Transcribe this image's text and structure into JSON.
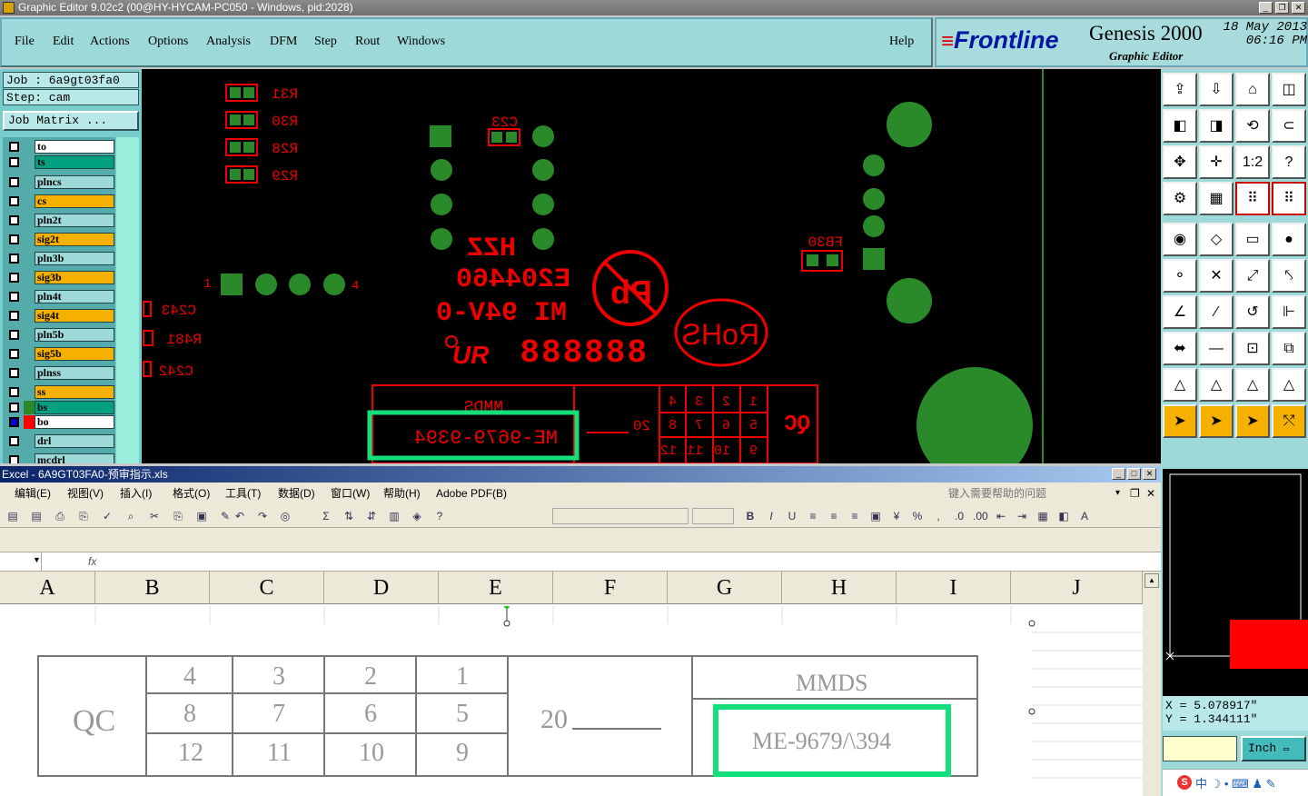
{
  "window": {
    "title": "Graphic Editor 9.02c2 (00@HY-HYCAM-PC050 - Windows, pid:2028)"
  },
  "menu": {
    "items": [
      "File",
      "Edit",
      "Actions",
      "Options",
      "Analysis",
      "DFM",
      "Step",
      "Rout",
      "Windows"
    ],
    "help": "Help"
  },
  "brand": {
    "logo": "Frontline",
    "product": "Genesis 2000",
    "subtitle": "Graphic Editor",
    "date": "18 May 2013",
    "time": "06:16 PM"
  },
  "job": {
    "job_line": "Job : 6a9gt03fa0",
    "step_line": "Step: cam",
    "matrix_button": "Job Matrix ..."
  },
  "layers": [
    {
      "name": "to",
      "bg": "#ffffff",
      "swatch": ""
    },
    {
      "name": "ts",
      "bg": "#00a080",
      "swatch": ""
    },
    {
      "name": "plncs",
      "bg": "#9ed9d9",
      "swatch": ""
    },
    {
      "name": "cs",
      "bg": "#f6b100",
      "swatch": ""
    },
    {
      "name": "pln2t",
      "bg": "#9ed9d9",
      "swatch": ""
    },
    {
      "name": "sig2t",
      "bg": "#f6b100",
      "swatch": ""
    },
    {
      "name": "pln3b",
      "bg": "#9ed9d9",
      "swatch": ""
    },
    {
      "name": "sig3b",
      "bg": "#f6b100",
      "swatch": ""
    },
    {
      "name": "pln4t",
      "bg": "#9ed9d9",
      "swatch": ""
    },
    {
      "name": "sig4t",
      "bg": "#f6b100",
      "swatch": ""
    },
    {
      "name": "pln5b",
      "bg": "#9ed9d9",
      "swatch": ""
    },
    {
      "name": "sig5b",
      "bg": "#f6b100",
      "swatch": ""
    },
    {
      "name": "plnss",
      "bg": "#9ed9d9",
      "swatch": ""
    },
    {
      "name": "ss",
      "bg": "#f6b100",
      "swatch": ""
    },
    {
      "name": "bs",
      "bg": "#00a080",
      "swatch": "#2a8a2a"
    },
    {
      "name": "bo",
      "bg": "#ffffff",
      "swatch": "#ff0000"
    },
    {
      "name": "drl",
      "bg": "#9ed9d9",
      "swatch": ""
    },
    {
      "name": "mcdrl",
      "bg": "#9ed9d9",
      "swatch": ""
    }
  ],
  "board": {
    "labels_resistors": [
      "R31",
      "R30",
      "R28",
      "R29"
    ],
    "label_c23": "C23",
    "label_fb30": "FB30",
    "labels_caps": [
      "C243",
      "R481",
      "C242"
    ],
    "pin1": "1",
    "pin4": "4",
    "marking_lines": [
      "HZZ",
      "E204460",
      "MI 94V-0"
    ],
    "date_code": "888888",
    "pb_text": "Pb",
    "rohs_text": "RoHS",
    "mmds": "MMDS",
    "part_number": "ME-9679-9394",
    "num20": "20",
    "qc": "QC",
    "grid": [
      [
        "4",
        "3",
        "2",
        "1"
      ],
      [
        "8",
        "7",
        "6",
        "5"
      ],
      [
        "12",
        "11",
        "10",
        "9"
      ]
    ]
  },
  "coords": {
    "x": "X = 5.078917\"",
    "y": "Y = 1.344111\""
  },
  "unit": "Inch",
  "excel": {
    "title": "Excel - 6A9GT03FA0-预审指示.xls",
    "menus": [
      "编辑(E)",
      "视图(V)",
      "插入(I)",
      "格式(O)",
      "工具(T)",
      "数据(D)",
      "窗口(W)",
      "帮助(H)",
      "Adobe PDF(B)"
    ],
    "help_placeholder": "键入需要帮助的问题",
    "fx": "fx",
    "columns": [
      "A",
      "B",
      "C",
      "D",
      "E",
      "F",
      "G",
      "H",
      "I",
      "J"
    ],
    "scan": {
      "qc": "QC",
      "grid": [
        [
          "4",
          "3",
          "2",
          "1"
        ],
        [
          "8",
          "7",
          "6",
          "5"
        ],
        [
          "12",
          "11",
          "10",
          "9"
        ]
      ],
      "num20": "20",
      "mmds": "MMDS",
      "part_number": "ME-9679/\\394"
    }
  }
}
